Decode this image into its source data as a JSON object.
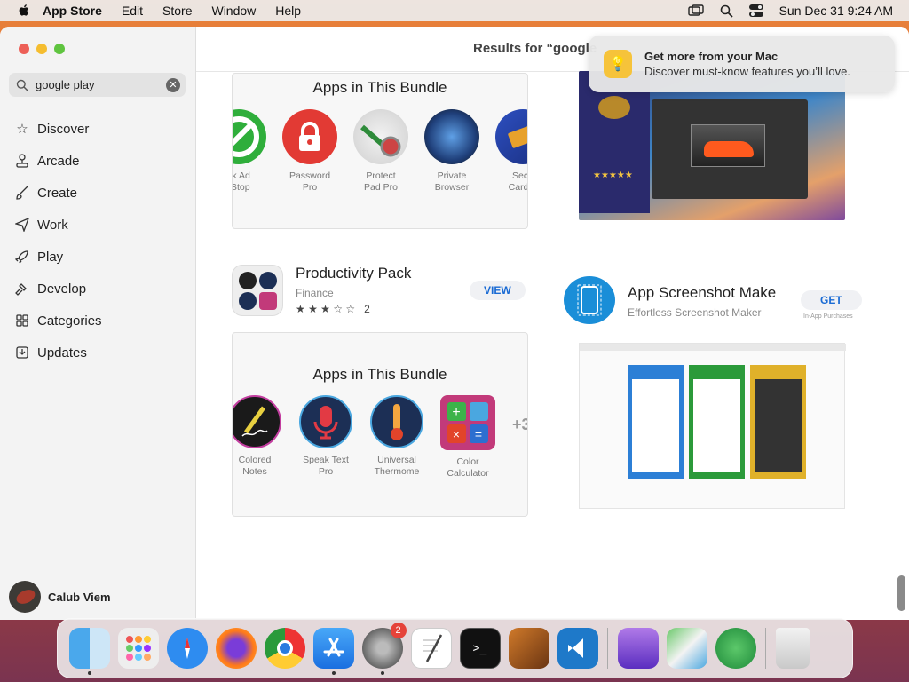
{
  "menubar": {
    "app": "App Store",
    "items": [
      "Edit",
      "Store",
      "Window",
      "Help"
    ],
    "datetime": "Sun Dec 31  9:24 AM"
  },
  "window": {
    "title": "Results for “google"
  },
  "search": {
    "value": "google play"
  },
  "sidebar": {
    "items": [
      {
        "label": "Discover",
        "icon": "star-icon"
      },
      {
        "label": "Arcade",
        "icon": "joystick-icon"
      },
      {
        "label": "Create",
        "icon": "brush-icon"
      },
      {
        "label": "Work",
        "icon": "paper-plane-icon"
      },
      {
        "label": "Play",
        "icon": "rocket-icon"
      },
      {
        "label": "Develop",
        "icon": "hammer-icon"
      },
      {
        "label": "Categories",
        "icon": "grid-icon"
      },
      {
        "label": "Updates",
        "icon": "download-icon"
      }
    ],
    "user": "Calub Viem"
  },
  "bundle1": {
    "heading": "Apps in This Bundle",
    "apps": [
      {
        "line1": "ck Ad",
        "line2": "-Stop",
        "color": "#2fae3b"
      },
      {
        "line1": "Password",
        "line2": "Pro",
        "color": "#e23a34"
      },
      {
        "line1": "Protect",
        "line2": "Pad Pro",
        "color": "#d8d8d8"
      },
      {
        "line1": "Private",
        "line2": "Browser",
        "color": "#1f3f7a"
      },
      {
        "line1": "Secu",
        "line2": "Card K",
        "color": "#2d4fc0"
      }
    ]
  },
  "productivity": {
    "name": "Productivity Pack",
    "category": "Finance",
    "stars": "★ ★ ★ ☆ ☆",
    "rating_count": "2",
    "button": "VIEW"
  },
  "bundle2": {
    "heading": "Apps in This Bundle",
    "more": "+3",
    "apps": [
      {
        "line1": "Colored",
        "line2": "Notes",
        "color": "#1a1a1a"
      },
      {
        "line1": "Speak Text",
        "line2": "Pro",
        "color": "#1c2f55"
      },
      {
        "line1": "Universal",
        "line2": "Thermome",
        "color": "#1c2f55"
      },
      {
        "line1": "Color",
        "line2": "Calculator",
        "color": "#c23a7a"
      }
    ]
  },
  "screenshot_app": {
    "name": "App Screenshot Make",
    "subtitle": "Effortless Screenshot Maker",
    "button": "GET",
    "inapp": "In-App Purchases"
  },
  "notification": {
    "title": "Get more from your Mac",
    "body": "Discover must-know features you’ll love."
  },
  "dock": {
    "badge": "2"
  }
}
